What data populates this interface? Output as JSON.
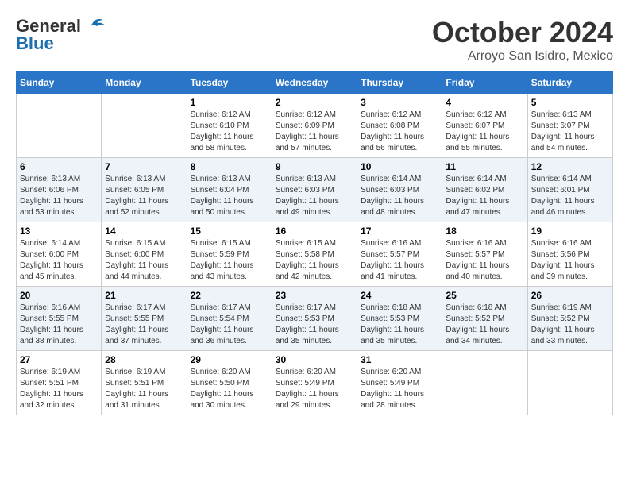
{
  "header": {
    "logo_general": "General",
    "logo_blue": "Blue",
    "month_title": "October 2024",
    "location": "Arroyo San Isidro, Mexico"
  },
  "calendar": {
    "days_of_week": [
      "Sunday",
      "Monday",
      "Tuesday",
      "Wednesday",
      "Thursday",
      "Friday",
      "Saturday"
    ],
    "weeks": [
      [
        {
          "day": null,
          "sunrise": null,
          "sunset": null,
          "daylight": null
        },
        {
          "day": null,
          "sunrise": null,
          "sunset": null,
          "daylight": null
        },
        {
          "day": "1",
          "sunrise": "Sunrise: 6:12 AM",
          "sunset": "Sunset: 6:10 PM",
          "daylight": "Daylight: 11 hours and 58 minutes."
        },
        {
          "day": "2",
          "sunrise": "Sunrise: 6:12 AM",
          "sunset": "Sunset: 6:09 PM",
          "daylight": "Daylight: 11 hours and 57 minutes."
        },
        {
          "day": "3",
          "sunrise": "Sunrise: 6:12 AM",
          "sunset": "Sunset: 6:08 PM",
          "daylight": "Daylight: 11 hours and 56 minutes."
        },
        {
          "day": "4",
          "sunrise": "Sunrise: 6:12 AM",
          "sunset": "Sunset: 6:07 PM",
          "daylight": "Daylight: 11 hours and 55 minutes."
        },
        {
          "day": "5",
          "sunrise": "Sunrise: 6:13 AM",
          "sunset": "Sunset: 6:07 PM",
          "daylight": "Daylight: 11 hours and 54 minutes."
        }
      ],
      [
        {
          "day": "6",
          "sunrise": "Sunrise: 6:13 AM",
          "sunset": "Sunset: 6:06 PM",
          "daylight": "Daylight: 11 hours and 53 minutes."
        },
        {
          "day": "7",
          "sunrise": "Sunrise: 6:13 AM",
          "sunset": "Sunset: 6:05 PM",
          "daylight": "Daylight: 11 hours and 52 minutes."
        },
        {
          "day": "8",
          "sunrise": "Sunrise: 6:13 AM",
          "sunset": "Sunset: 6:04 PM",
          "daylight": "Daylight: 11 hours and 50 minutes."
        },
        {
          "day": "9",
          "sunrise": "Sunrise: 6:13 AM",
          "sunset": "Sunset: 6:03 PM",
          "daylight": "Daylight: 11 hours and 49 minutes."
        },
        {
          "day": "10",
          "sunrise": "Sunrise: 6:14 AM",
          "sunset": "Sunset: 6:03 PM",
          "daylight": "Daylight: 11 hours and 48 minutes."
        },
        {
          "day": "11",
          "sunrise": "Sunrise: 6:14 AM",
          "sunset": "Sunset: 6:02 PM",
          "daylight": "Daylight: 11 hours and 47 minutes."
        },
        {
          "day": "12",
          "sunrise": "Sunrise: 6:14 AM",
          "sunset": "Sunset: 6:01 PM",
          "daylight": "Daylight: 11 hours and 46 minutes."
        }
      ],
      [
        {
          "day": "13",
          "sunrise": "Sunrise: 6:14 AM",
          "sunset": "Sunset: 6:00 PM",
          "daylight": "Daylight: 11 hours and 45 minutes."
        },
        {
          "day": "14",
          "sunrise": "Sunrise: 6:15 AM",
          "sunset": "Sunset: 6:00 PM",
          "daylight": "Daylight: 11 hours and 44 minutes."
        },
        {
          "day": "15",
          "sunrise": "Sunrise: 6:15 AM",
          "sunset": "Sunset: 5:59 PM",
          "daylight": "Daylight: 11 hours and 43 minutes."
        },
        {
          "day": "16",
          "sunrise": "Sunrise: 6:15 AM",
          "sunset": "Sunset: 5:58 PM",
          "daylight": "Daylight: 11 hours and 42 minutes."
        },
        {
          "day": "17",
          "sunrise": "Sunrise: 6:16 AM",
          "sunset": "Sunset: 5:57 PM",
          "daylight": "Daylight: 11 hours and 41 minutes."
        },
        {
          "day": "18",
          "sunrise": "Sunrise: 6:16 AM",
          "sunset": "Sunset: 5:57 PM",
          "daylight": "Daylight: 11 hours and 40 minutes."
        },
        {
          "day": "19",
          "sunrise": "Sunrise: 6:16 AM",
          "sunset": "Sunset: 5:56 PM",
          "daylight": "Daylight: 11 hours and 39 minutes."
        }
      ],
      [
        {
          "day": "20",
          "sunrise": "Sunrise: 6:16 AM",
          "sunset": "Sunset: 5:55 PM",
          "daylight": "Daylight: 11 hours and 38 minutes."
        },
        {
          "day": "21",
          "sunrise": "Sunrise: 6:17 AM",
          "sunset": "Sunset: 5:55 PM",
          "daylight": "Daylight: 11 hours and 37 minutes."
        },
        {
          "day": "22",
          "sunrise": "Sunrise: 6:17 AM",
          "sunset": "Sunset: 5:54 PM",
          "daylight": "Daylight: 11 hours and 36 minutes."
        },
        {
          "day": "23",
          "sunrise": "Sunrise: 6:17 AM",
          "sunset": "Sunset: 5:53 PM",
          "daylight": "Daylight: 11 hours and 35 minutes."
        },
        {
          "day": "24",
          "sunrise": "Sunrise: 6:18 AM",
          "sunset": "Sunset: 5:53 PM",
          "daylight": "Daylight: 11 hours and 35 minutes."
        },
        {
          "day": "25",
          "sunrise": "Sunrise: 6:18 AM",
          "sunset": "Sunset: 5:52 PM",
          "daylight": "Daylight: 11 hours and 34 minutes."
        },
        {
          "day": "26",
          "sunrise": "Sunrise: 6:19 AM",
          "sunset": "Sunset: 5:52 PM",
          "daylight": "Daylight: 11 hours and 33 minutes."
        }
      ],
      [
        {
          "day": "27",
          "sunrise": "Sunrise: 6:19 AM",
          "sunset": "Sunset: 5:51 PM",
          "daylight": "Daylight: 11 hours and 32 minutes."
        },
        {
          "day": "28",
          "sunrise": "Sunrise: 6:19 AM",
          "sunset": "Sunset: 5:51 PM",
          "daylight": "Daylight: 11 hours and 31 minutes."
        },
        {
          "day": "29",
          "sunrise": "Sunrise: 6:20 AM",
          "sunset": "Sunset: 5:50 PM",
          "daylight": "Daylight: 11 hours and 30 minutes."
        },
        {
          "day": "30",
          "sunrise": "Sunrise: 6:20 AM",
          "sunset": "Sunset: 5:49 PM",
          "daylight": "Daylight: 11 hours and 29 minutes."
        },
        {
          "day": "31",
          "sunrise": "Sunrise: 6:20 AM",
          "sunset": "Sunset: 5:49 PM",
          "daylight": "Daylight: 11 hours and 28 minutes."
        },
        {
          "day": null,
          "sunrise": null,
          "sunset": null,
          "daylight": null
        },
        {
          "day": null,
          "sunrise": null,
          "sunset": null,
          "daylight": null
        }
      ]
    ]
  }
}
